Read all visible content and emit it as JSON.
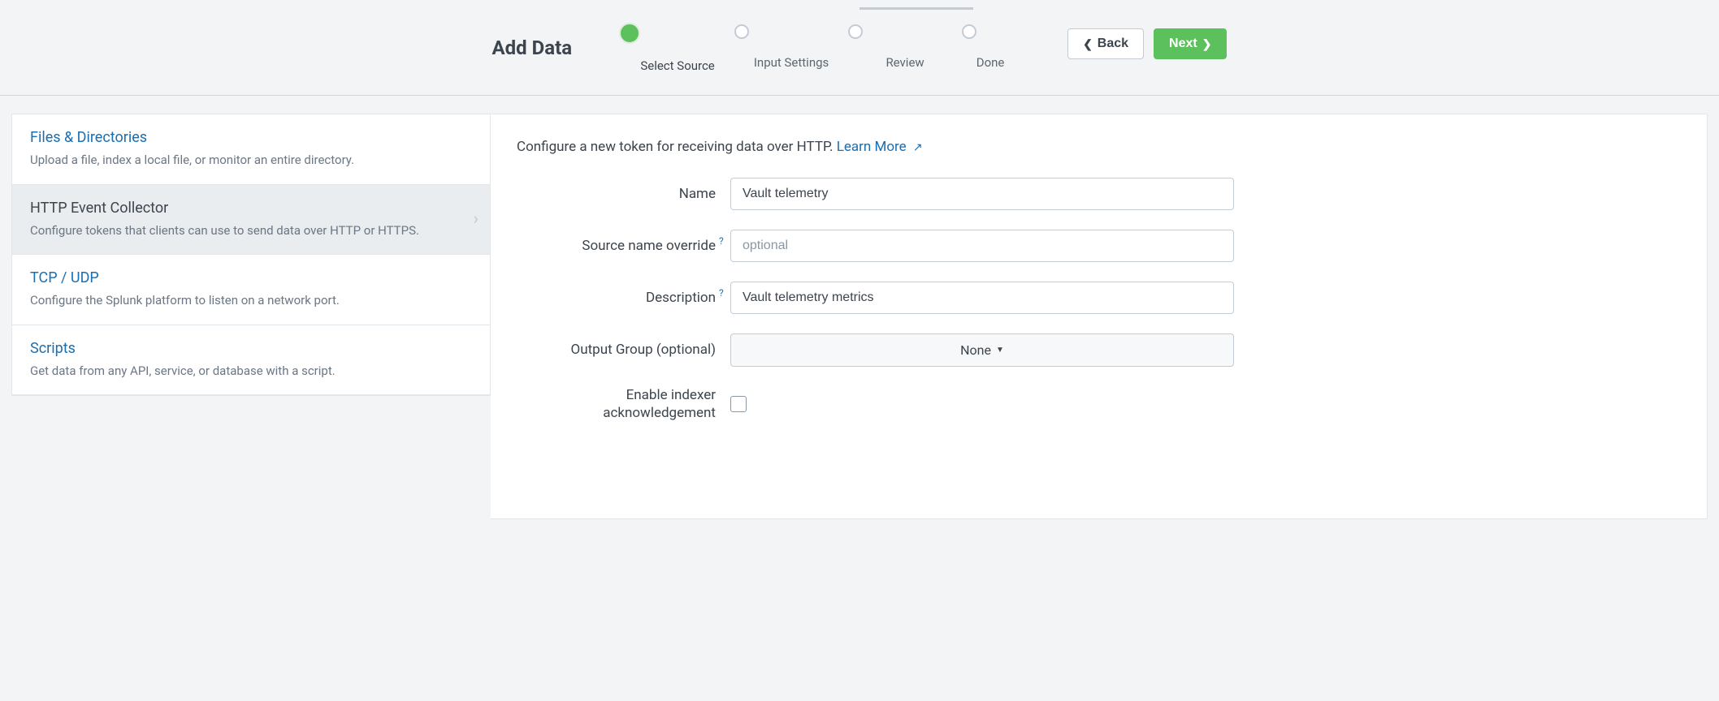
{
  "header": {
    "title": "Add Data",
    "steps": [
      {
        "label": "Select Source",
        "active": true
      },
      {
        "label": "Input Settings",
        "active": false
      },
      {
        "label": "Review",
        "active": false
      },
      {
        "label": "Done",
        "active": false
      }
    ],
    "back_label": "Back",
    "next_label": "Next"
  },
  "sidebar": {
    "items": [
      {
        "title": "Files & Directories",
        "desc": "Upload a file, index a local file, or monitor an entire directory.",
        "selected": false
      },
      {
        "title": "HTTP Event Collector",
        "desc": "Configure tokens that clients can use to send data over HTTP or HTTPS.",
        "selected": true
      },
      {
        "title": "TCP / UDP",
        "desc": "Configure the Splunk platform to listen on a network port.",
        "selected": false
      },
      {
        "title": "Scripts",
        "desc": "Get data from any API, service, or database with a script.",
        "selected": false
      }
    ]
  },
  "main": {
    "intro_text": "Configure a new token for receiving data over HTTP. ",
    "learn_more": "Learn More",
    "fields": {
      "name": {
        "label": "Name",
        "value": "Vault telemetry"
      },
      "source_override": {
        "label": "Source name override",
        "placeholder": "optional",
        "help": "?"
      },
      "description": {
        "label": "Description",
        "value": "Vault telemetry metrics",
        "help": "?"
      },
      "output_group": {
        "label": "Output Group (optional)",
        "selected": "None"
      },
      "indexer_ack": {
        "label": "Enable indexer acknowledgement"
      }
    }
  }
}
